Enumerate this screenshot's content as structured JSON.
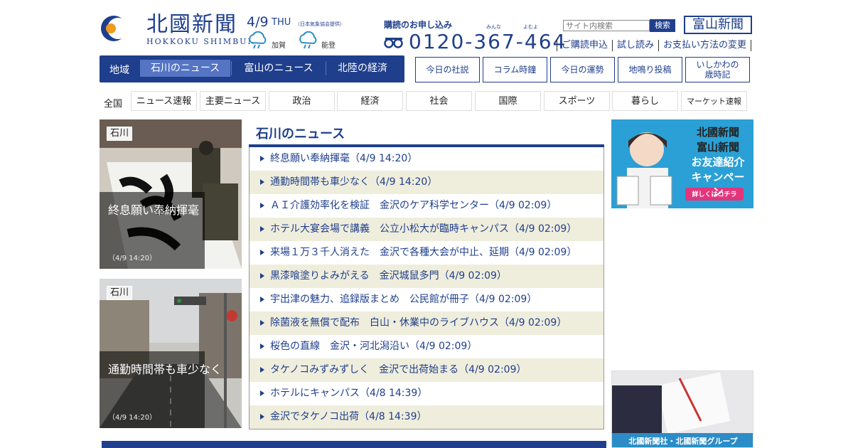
{
  "header": {
    "logo": "北國新聞",
    "logo_sub": "HOKKOKU SHIMBUN",
    "date": "4/9",
    "dow": "THU",
    "weather_note": "（日本気象協会提供）",
    "weather": [
      {
        "icon": "cloud-rain-icon",
        "label": "加賀"
      },
      {
        "icon": "cloud-rain-icon",
        "label": "能登"
      }
    ],
    "subscribe_title": "購読のお申し込み",
    "ruby_1": "みんな",
    "ruby_2": "よむよ",
    "phone": "0120-367-464",
    "search_placeholder": "サイト内検索",
    "search_button": "検索",
    "toyama_logo": "富山新聞",
    "sublinks": [
      "ご購読申込",
      "試し読み",
      "お支払い方法の変更"
    ]
  },
  "region_nav": {
    "label": "地域",
    "tabs": [
      "石川のニュース",
      "富山のニュース",
      "北陸の経済"
    ],
    "active_index": 0
  },
  "column_buttons": [
    "今日の社説",
    "コラム時鐘",
    "今日の運勢",
    "地鳴り投稿",
    "いしかわの\n歳時記"
  ],
  "category_nav": {
    "all": "全国",
    "items": [
      "ニュース速報",
      "主要ニュース",
      "政治",
      "経済",
      "社会",
      "国際",
      "スポーツ",
      "暮らし",
      "マーケット速報"
    ]
  },
  "photo_cards": [
    {
      "tag": "石川",
      "caption": "終息願い奉納揮毫",
      "time": "（4/9 14:20）"
    },
    {
      "tag": "石川",
      "caption": "通勤時間帯も車少なく",
      "time": "（4/9 14:20）"
    }
  ],
  "news": {
    "title": "石川のニュース",
    "items": [
      "終息願い奉納揮毫（4/9 14:20）",
      "通勤時間帯も車少なく（4/9 14:20）",
      "ＡＩ介護効率化を検証　金沢のケア科学センター（4/9 02:09）",
      "ホテル大宴会場で講義　公立小松大が臨時キャンパス（4/9 02:09）",
      "来場１万３千人消えた　金沢で各種大会が中止、延期（4/9 02:09）",
      "黒漆喰塗りよみがえる　金沢城鼠多門（4/9 02:09）",
      "宇出津の魅力、追録版まとめ　公民館が冊子（4/9 02:09）",
      "除菌液を無償で配布　白山・休業中のライブハウス（4/9 02:09）",
      "桜色の直線　金沢・河北潟沿い（4/9 02:09）",
      "タケノコみずみずしく　金沢で出荷始まる（4/9 02:09）",
      "ホテルにキャンパス（4/8 14:39）",
      "金沢でタケノコ出荷（4/8 14:39）"
    ]
  },
  "ads": {
    "ad1_lines": [
      "北國新聞",
      "富山新聞",
      "お友達紹介",
      "キャンペーン"
    ],
    "ad1_button": "詳しくはコチラ",
    "ad2_text": "北國新聞社・北國新聞グループ"
  },
  "colors": {
    "brand": "#1f3f8c",
    "alt_row": "#efeddc"
  }
}
